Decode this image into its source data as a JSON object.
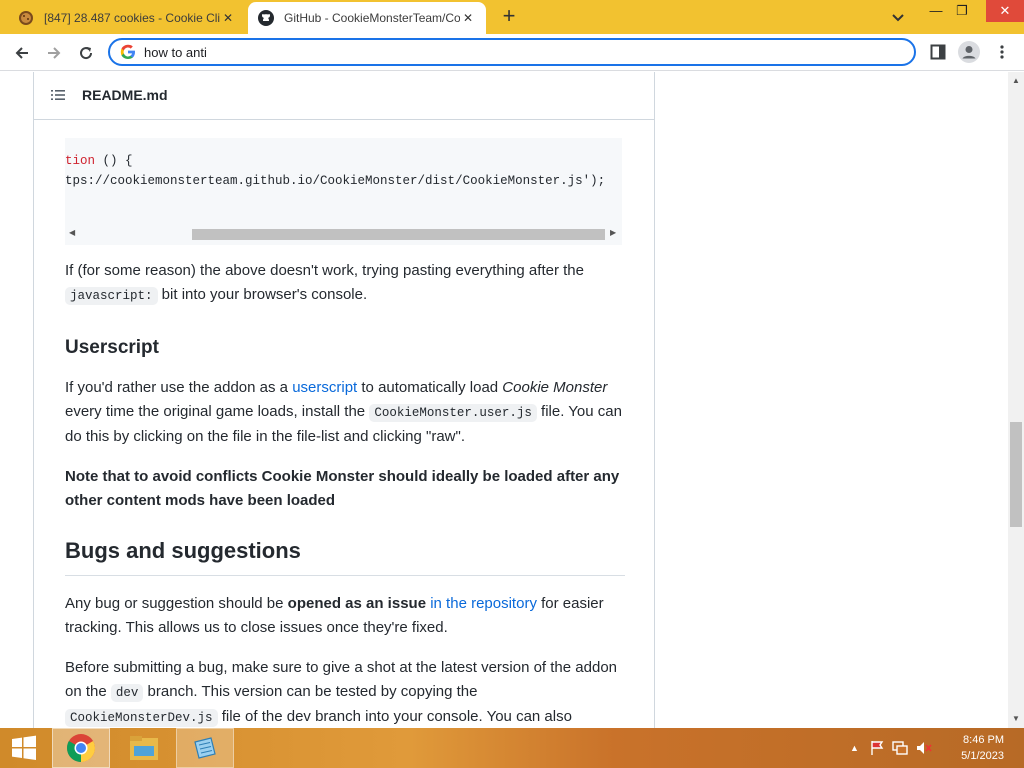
{
  "browser": {
    "tabs": [
      {
        "title": "[847] 28.487 cookies - Cookie Cli",
        "active": false
      },
      {
        "title": "GitHub - CookieMonsterTeam/Co",
        "active": true
      }
    ],
    "address_text": "how to anti ",
    "accent_color": "#1a73e8",
    "titlebar_color": "#f2c230"
  },
  "readme": {
    "filename": "README.md",
    "code_line_1_kw": "tion",
    "code_line_1_rest": " () {",
    "code_line_2": "tps://cookiemonsterteam.github.io/CookieMonster/dist/CookieMonster.js');",
    "para1_a": "If (for some reason) the above doesn't work, trying pasting everything after the",
    "para1_code": "javascript:",
    "para1_b": " bit into your browser's console.",
    "userscript_heading": "Userscript",
    "para2_a": "If you'd rather use the addon as a ",
    "para2_link": "userscript",
    "para2_b": " to automatically load ",
    "para2_em": "Cookie Monster",
    "para2_c": " every time the original game loads, install the ",
    "para2_code": "CookieMonster.user.js",
    "para2_d": " file. You can do this by clicking on the file in the file-list and clicking \"raw\".",
    "note": "Note that to avoid conflicts Cookie Monster should ideally be loaded after any other content mods have been loaded",
    "bugs_heading": "Bugs and suggestions",
    "para3_a": "Any bug or suggestion should be ",
    "para3_strong": "opened as an issue",
    "para3_b": " ",
    "para3_link": "in the repository",
    "para3_c": " for easier tracking. This allows us to close issues once they're fixed.",
    "para4_a": "Before submitting a bug, make sure to give a shot at the latest version of the addon on the ",
    "para4_code1": "dev",
    "para4_b": " branch. This version can be tested by copying the ",
    "para4_code2": "CookieMonsterDev.js",
    "para4_c": " file of the dev branch into your console. You can also"
  },
  "taskbar": {
    "time": "8:46 PM",
    "date": "5/1/2023",
    "icons": [
      "start-icon",
      "chrome-icon",
      "file-explorer-icon",
      "notepad-icon"
    ]
  }
}
